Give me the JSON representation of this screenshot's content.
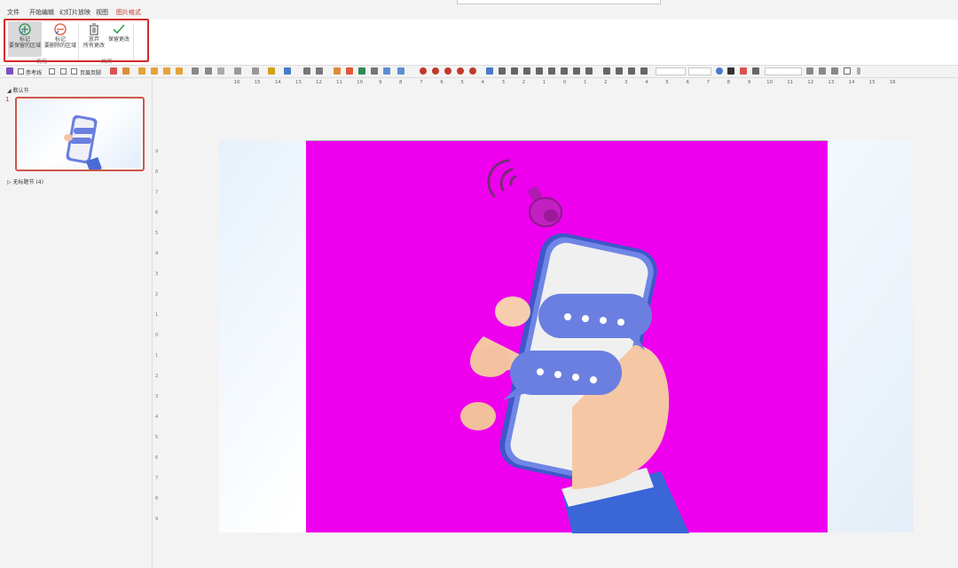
{
  "menu": {
    "tabs": [
      "文件",
      "开始编辑",
      "幻灯片放映",
      "视图",
      "图片格式"
    ],
    "active_tab": "图片格式"
  },
  "ribbon": {
    "buttons": {
      "mark_keep": "标记\n要保留的区域",
      "mark_delete": "标记\n要删除的区域",
      "discard": "放弃\n所有更改",
      "keep_changes": "保留更改"
    },
    "groups": {
      "optimize": "优化",
      "close": "关闭"
    }
  },
  "format_bar": {
    "checkbox_1": "参考线",
    "checkbox_2": "页眉页脚"
  },
  "ruler": {
    "h_ticks": [
      "16",
      "15",
      "14",
      "13",
      "12",
      "11",
      "10",
      "9",
      "8",
      "7",
      "6",
      "5",
      "4",
      "3",
      "2",
      "1",
      "0",
      "1",
      "2",
      "3",
      "4",
      "5",
      "6",
      "7",
      "8",
      "9",
      "10",
      "11",
      "12",
      "13",
      "14",
      "15",
      "16"
    ],
    "v_ticks": [
      "9",
      "8",
      "7",
      "6",
      "5",
      "4",
      "3",
      "2",
      "1",
      "0",
      "1",
      "2",
      "3",
      "4",
      "5",
      "6",
      "7",
      "8",
      "9"
    ]
  },
  "slides_pane": {
    "default_section": "默认节",
    "slide_number": "1",
    "untitled_section": "无标题节 (4)"
  },
  "colors": {
    "accent": "#d42a2a",
    "magenta_fill": "#ee00ee",
    "phone_blue": "#6a7fe0"
  }
}
